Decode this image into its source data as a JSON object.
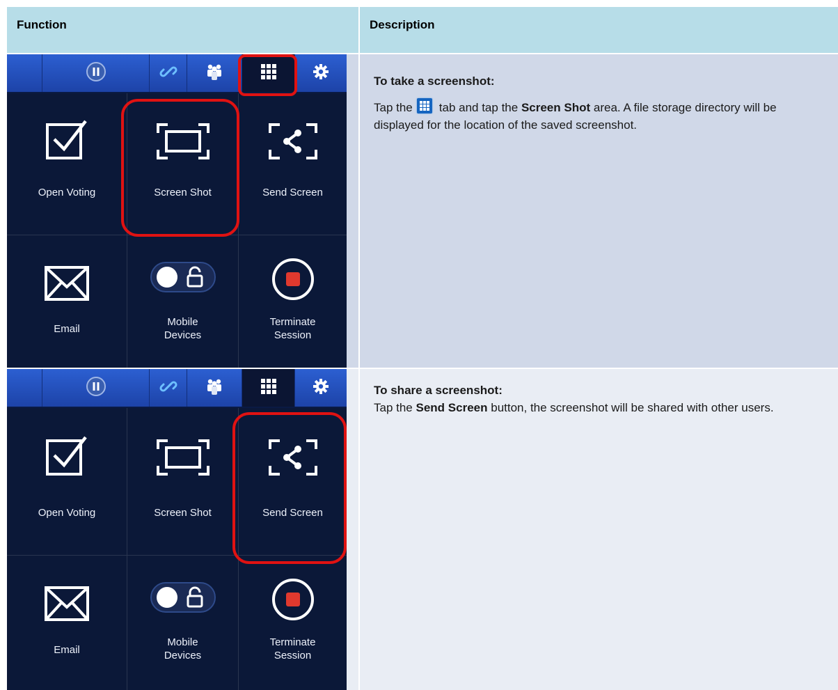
{
  "table": {
    "headers": {
      "function": "Function",
      "description": "Description"
    },
    "rows": [
      {
        "heading": "To take a screenshot:",
        "text_before_icon": "Tap the",
        "icon": "grid-icon",
        "text_after_icon": "tab and tap the",
        "bold_term": "Screen Shot",
        "text_after_term": "area. A file storage directory will be displayed for the location of the saved screenshot."
      },
      {
        "heading": "To share a screenshot:",
        "text_before_term": "Tap the",
        "bold_term": "Send Screen",
        "text_after_term": "button, the screenshot will be shared with other users."
      }
    ]
  },
  "app": {
    "tabs": [
      "pause-icon",
      "link-icon",
      "people-icon",
      "grid-icon",
      "gear-icon"
    ],
    "tiles": {
      "open_voting": "Open Voting",
      "screen_shot": "Screen Shot",
      "send_screen": "Send Screen",
      "email": "Email",
      "mobile_devices_1": "Mobile",
      "mobile_devices_2": "Devices",
      "terminate_1": "Terminate",
      "terminate_2": "Session"
    }
  },
  "colors": {
    "header": "#b7dde8",
    "row1": "#d0d8e8",
    "row2": "#e9edf4",
    "highlight": "#e01212",
    "app_bg": "#0b1838",
    "tabbar": "#2c5fd1"
  }
}
